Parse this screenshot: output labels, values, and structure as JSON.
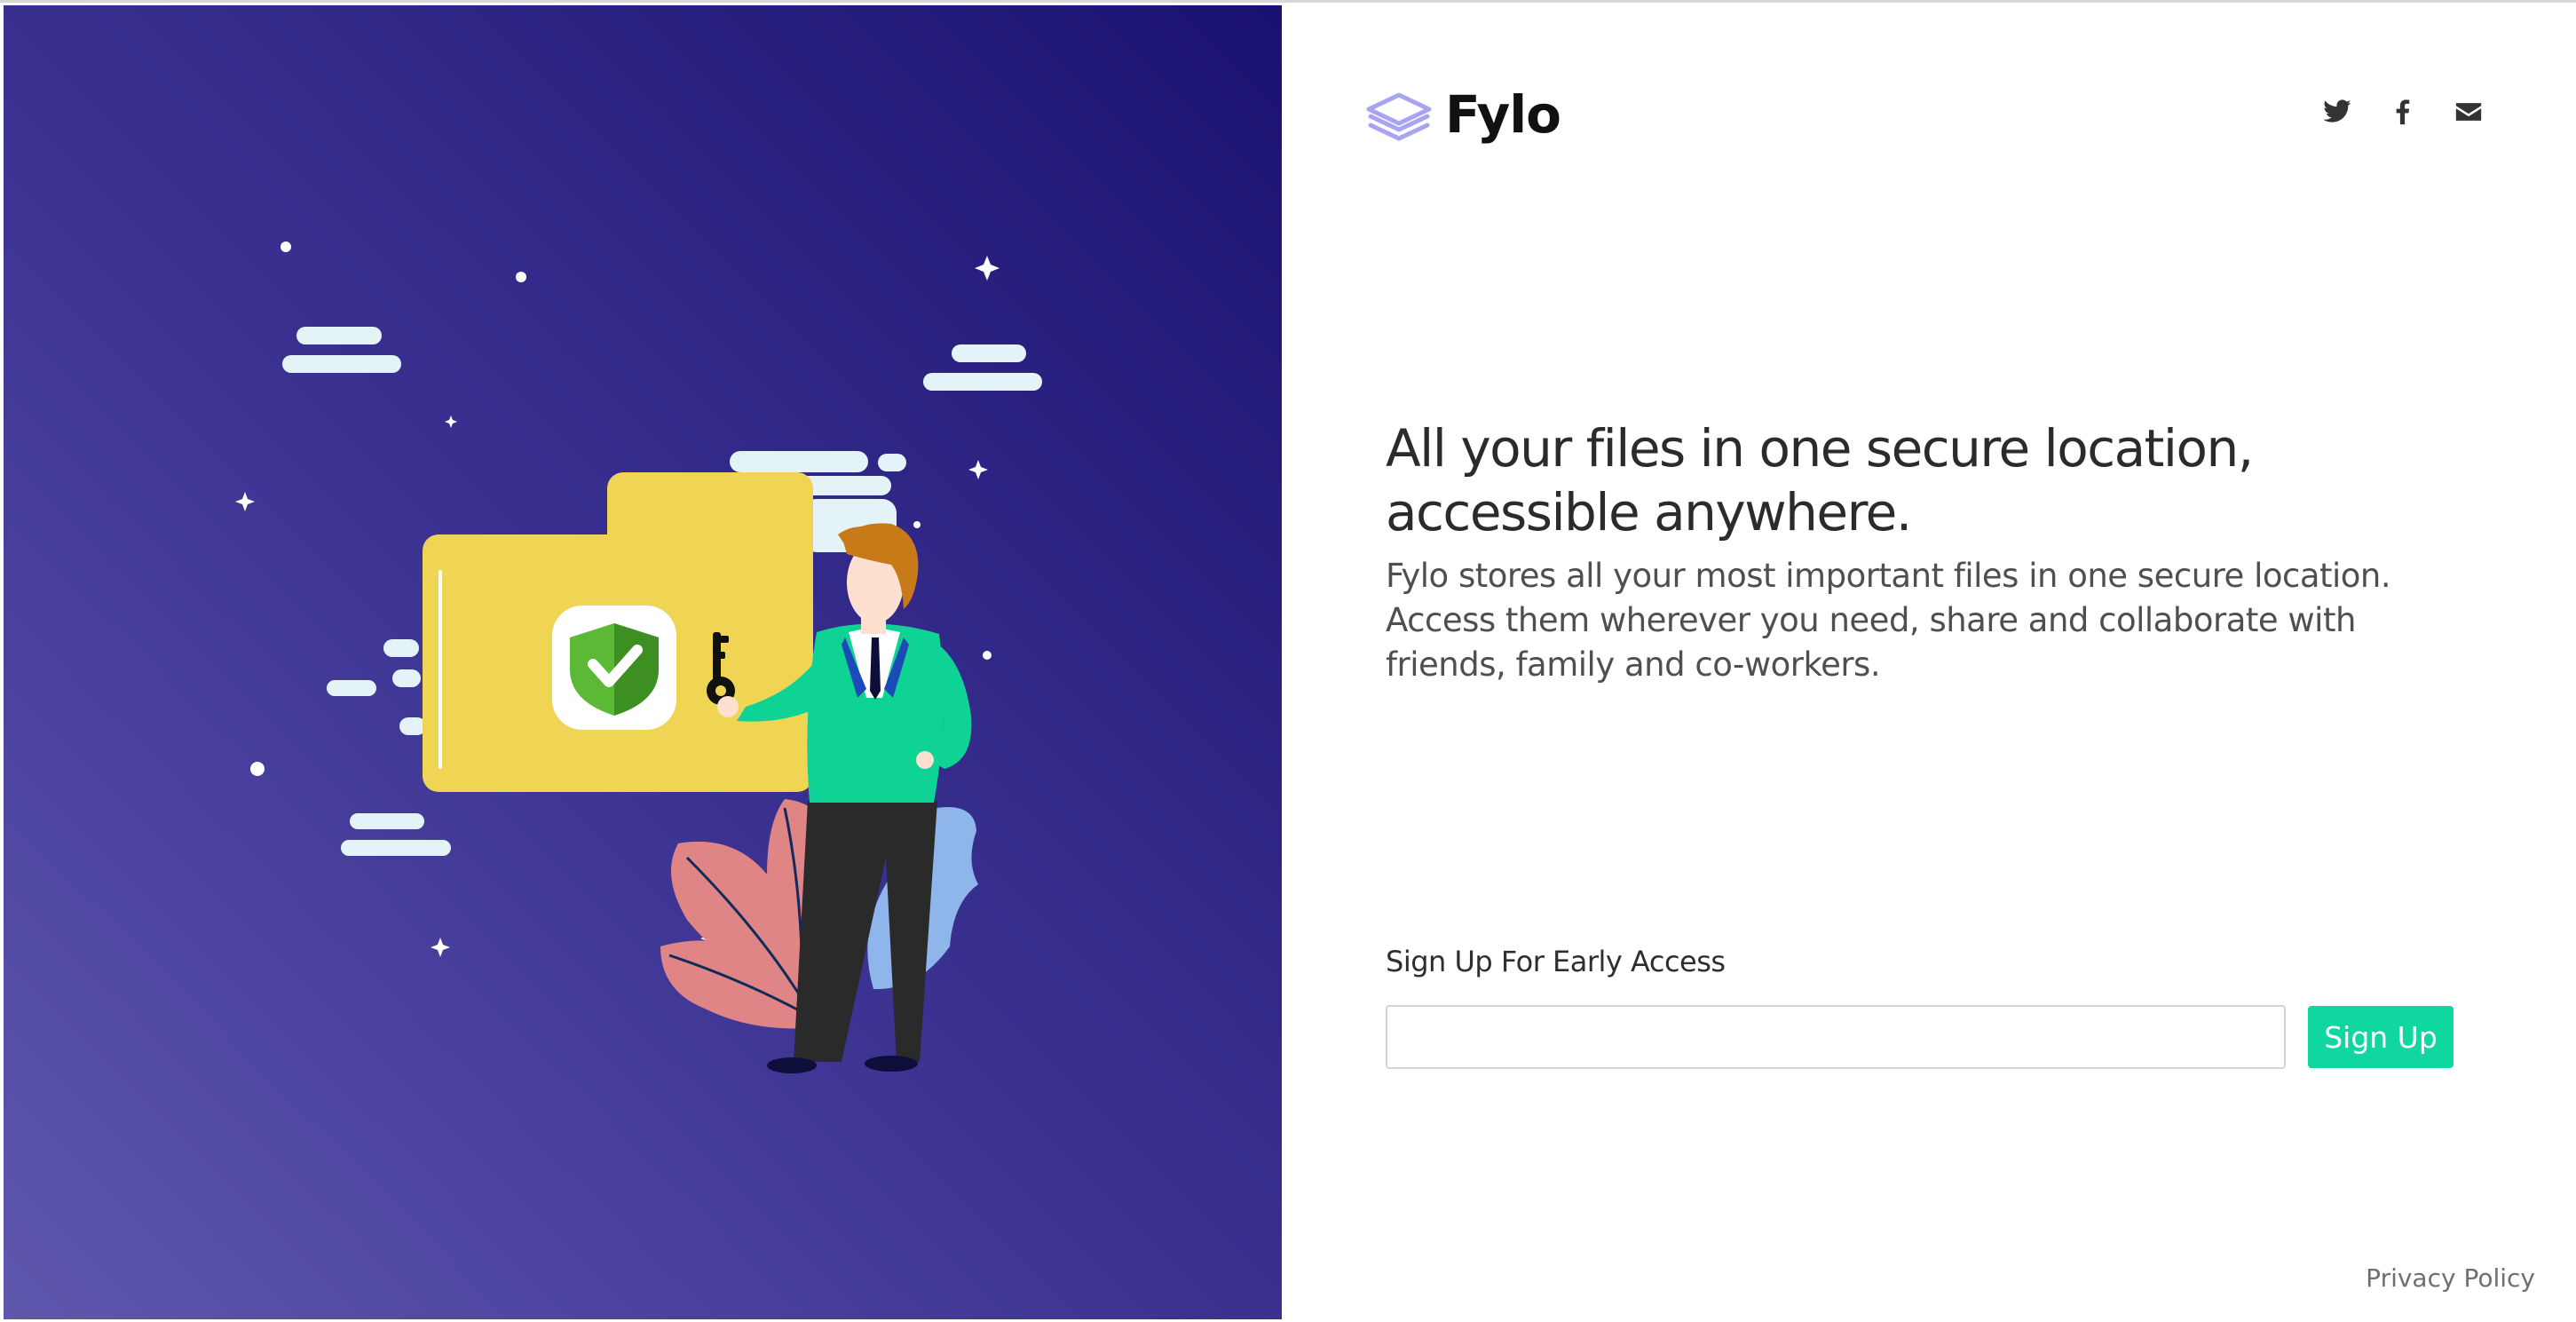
{
  "brand": {
    "name": "Fylo",
    "logo_icon": "stacked-layers-icon",
    "logo_color": "#a9a4f2"
  },
  "social": [
    {
      "name": "twitter",
      "icon": "twitter-icon"
    },
    {
      "name": "facebook",
      "icon": "facebook-icon"
    },
    {
      "name": "email",
      "icon": "envelope-icon"
    }
  ],
  "hero": {
    "headline": "All your files in one secure location, accessible anywhere.",
    "subtext": "Fylo stores all your most important files in one secure location. Access them wherever you need, share and collaborate with friends, family and co-workers.",
    "illustration": "man-holding-key-with-secure-folder-illustration"
  },
  "signup": {
    "label": "Sign Up For Early Access",
    "input_value": "",
    "input_placeholder": "",
    "button_label": "Sign Up"
  },
  "footer": {
    "privacy_link": "Privacy Policy"
  },
  "colors": {
    "hero_gradient_start": "#5e58ad",
    "hero_gradient_end": "#1a1272",
    "accent": "#10d6a0",
    "headline_text": "#2b2b2b"
  }
}
